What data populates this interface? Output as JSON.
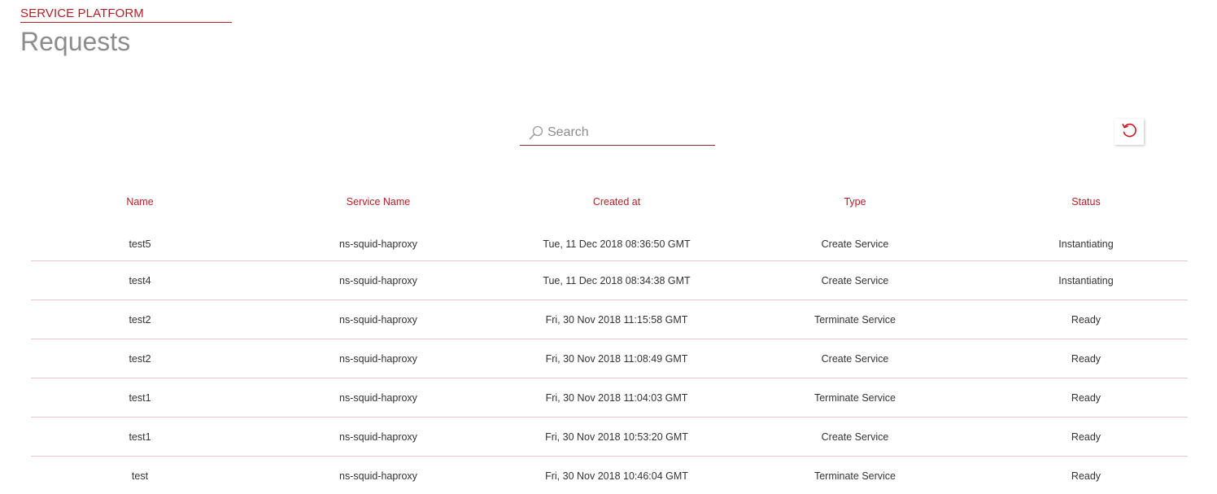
{
  "header": {
    "breadcrumb": "SERVICE PLATFORM",
    "title": "Requests"
  },
  "search": {
    "placeholder": "Search",
    "value": ""
  },
  "icons": {
    "search": "search-icon",
    "refresh": "refresh-icon"
  },
  "colors": {
    "accent": "#b31f24",
    "title": "#8c8c8c",
    "row_divider": "#f0c6c8"
  },
  "table": {
    "columns": [
      "Name",
      "Service Name",
      "Created at",
      "Type",
      "Status"
    ],
    "rows": [
      [
        "test5",
        "ns-squid-haproxy",
        "Tue, 11 Dec 2018 08:36:50 GMT",
        "Create Service",
        "Instantiating"
      ],
      [
        "test4",
        "ns-squid-haproxy",
        "Tue, 11 Dec 2018 08:34:38 GMT",
        "Create Service",
        "Instantiating"
      ],
      [
        "test2",
        "ns-squid-haproxy",
        "Fri, 30 Nov 2018 11:15:58 GMT",
        "Terminate Service",
        "Ready"
      ],
      [
        "test2",
        "ns-squid-haproxy",
        "Fri, 30 Nov 2018 11:08:49 GMT",
        "Create Service",
        "Ready"
      ],
      [
        "test1",
        "ns-squid-haproxy",
        "Fri, 30 Nov 2018 11:04:03 GMT",
        "Terminate Service",
        "Ready"
      ],
      [
        "test1",
        "ns-squid-haproxy",
        "Fri, 30 Nov 2018 10:53:20 GMT",
        "Create Service",
        "Ready"
      ],
      [
        "test",
        "ns-squid-haproxy",
        "Fri, 30 Nov 2018 10:46:04 GMT",
        "Terminate Service",
        "Ready"
      ]
    ]
  }
}
